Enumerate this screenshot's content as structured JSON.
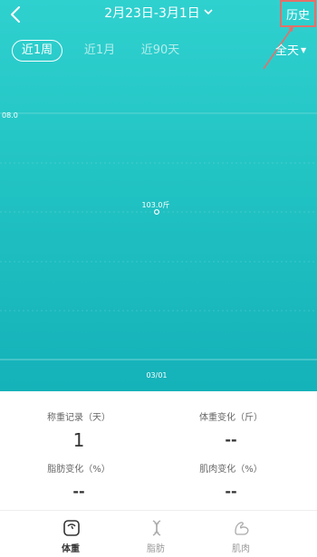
{
  "header": {
    "range_title": "2月23日-3月1日",
    "history_label": "历史"
  },
  "tabs": [
    {
      "label": "近1周",
      "active": true
    },
    {
      "label": "近1月",
      "active": false
    },
    {
      "label": "近90天",
      "active": false
    }
  ],
  "period_select": {
    "label": "全天"
  },
  "chart": {
    "y_tick_label": "08.0",
    "point_label": "103.0斤",
    "x_tick_label": "03/01"
  },
  "stats": [
    {
      "label": "称重记录（天）",
      "value": "1"
    },
    {
      "label": "体重变化（斤）",
      "value": "--"
    },
    {
      "label": "脂肪变化（%）",
      "value": "--"
    },
    {
      "label": "肌肉变化（%）",
      "value": "--"
    }
  ],
  "nav": [
    {
      "label": "体重",
      "icon": "scale-icon",
      "active": true
    },
    {
      "label": "脂肪",
      "icon": "dna-icon",
      "active": false
    },
    {
      "label": "肌肉",
      "icon": "muscle-icon",
      "active": false
    }
  ],
  "colors": {
    "chart_bg_top": "#2fd1cf",
    "chart_bg_bottom": "#14b2b9",
    "annotation": "#e2716a"
  },
  "chart_data": {
    "type": "line",
    "x": [
      "03/01"
    ],
    "series": [
      {
        "values": [
          103.0
        ]
      }
    ],
    "ylabel": "",
    "xlabel": "",
    "grid": true
  }
}
